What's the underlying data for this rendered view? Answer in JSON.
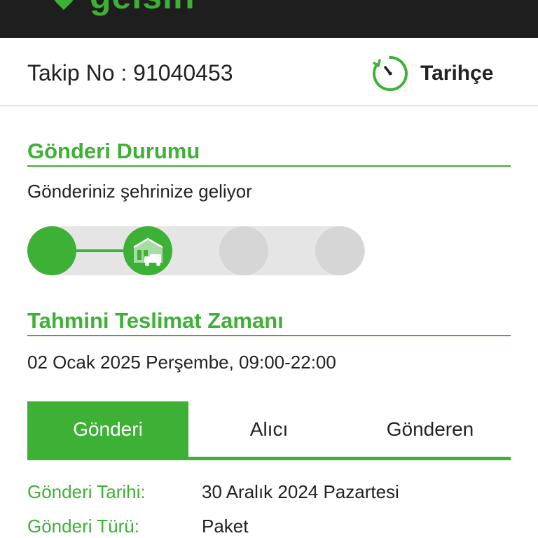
{
  "header": {
    "logo_text": "gelsin",
    "brand_color": "#3db135"
  },
  "tracking": {
    "label": "Takip No : 91040453",
    "history_label": "Tarihçe",
    "history_icon": "clock-history-icon"
  },
  "status": {
    "title": "Gönderi Durumu",
    "text": "Gönderiniz şehrinize geliyor",
    "steps_completed": 2,
    "steps_total": 4
  },
  "delivery": {
    "title": "Tahmini Teslimat Zamanı",
    "text": "02 Ocak 2025 Perşembe, 09:00-22:00"
  },
  "tabs": [
    {
      "label": "Gönderi",
      "active": true
    },
    {
      "label": "Alıcı",
      "active": false
    },
    {
      "label": "Gönderen",
      "active": false
    }
  ],
  "details": [
    {
      "key": "Gönderi Tarihi:",
      "value": "30 Aralık 2024 Pazartesi"
    },
    {
      "key": "Gönderi Türü:",
      "value": "Paket"
    }
  ]
}
